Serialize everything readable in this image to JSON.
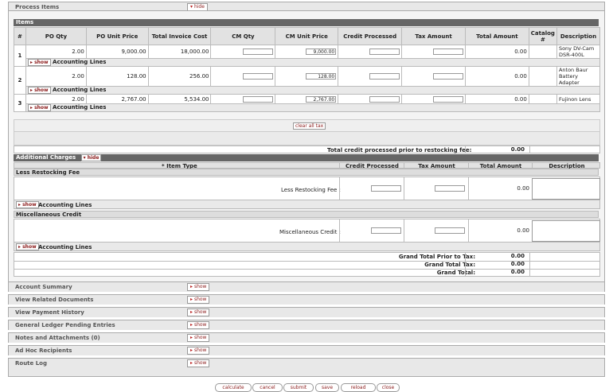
{
  "process_items": {
    "title": "Process Items",
    "hide_label": "hide"
  },
  "items": {
    "header": "Items",
    "columns": [
      "#",
      "PO Qty",
      "PO Unit Price",
      "Total Invoice Cost",
      "CM Qty",
      "CM Unit Price",
      "Credit Processed",
      "Tax Amount",
      "Total Amount",
      "Catalog #",
      "Description"
    ],
    "rows": [
      {
        "num": "1",
        "po_qty": "2.00",
        "po_unit_price": "9,000.00",
        "total_invoice_cost": "18,000.00",
        "cm_qty": "",
        "cm_unit_price": "9,000.00",
        "credit_processed": "",
        "tax_amount": "",
        "total_amount": "0.00",
        "catalog": "",
        "description": "Sony DV-Cam DSR-400L"
      },
      {
        "num": "2",
        "po_qty": "2.00",
        "po_unit_price": "128.00",
        "total_invoice_cost": "256.00",
        "cm_qty": "",
        "cm_unit_price": "128.00",
        "credit_processed": "",
        "tax_amount": "",
        "total_amount": "0.00",
        "catalog": "",
        "description": "Anton Baur Battery Adapter"
      },
      {
        "num": "3",
        "po_qty": "2.00",
        "po_unit_price": "2,767.00",
        "total_invoice_cost": "5,534.00",
        "cm_qty": "",
        "cm_unit_price": "2,767.00",
        "credit_processed": "",
        "tax_amount": "",
        "total_amount": "0.00",
        "catalog": "",
        "description": "Fujinon Lens"
      }
    ],
    "accounting_lines_label": "Accounting Lines",
    "show_label": "show",
    "clear_all_tax": "clear all tax",
    "total_credit_label": "Total credit processed prior to restocking fee:",
    "total_credit_value": "0.00"
  },
  "additional_charges": {
    "header": "Additional Charges",
    "hide_label": "hide",
    "columns": [
      "* Item Type",
      "Credit Processed",
      "Tax Amount",
      "Total Amount",
      "Description"
    ],
    "less_restocking": {
      "title": "Less Restocking Fee",
      "label": "Less Restocking Fee :",
      "total": "0.00"
    },
    "misc_credit": {
      "title": "Miscellaneous Credit",
      "label": "Miscellaneous Credit :",
      "total": "0.00"
    },
    "grand_total_prior_tax_label": "Grand Total Prior to Tax:",
    "grand_total_prior_tax": "0.00",
    "grand_total_tax_label": "Grand Total Tax:",
    "grand_total_tax": "0.00",
    "grand_total_label": "Grand Total:",
    "grand_total": "0.00"
  },
  "tabs": [
    {
      "title": "Account Summary",
      "show": "show"
    },
    {
      "title": "View Related Documents",
      "show": "show"
    },
    {
      "title": "View Payment History",
      "show": "show"
    },
    {
      "title": "General Ledger Pending Entries",
      "show": "show"
    },
    {
      "title": "Notes and Attachments (0)",
      "show": "show"
    },
    {
      "title": "Ad Hoc Recipients",
      "show": "show"
    },
    {
      "title": "Route Log",
      "show": "show"
    }
  ],
  "footer_buttons": [
    "calculate",
    "cancel",
    "submit",
    "save",
    "reload",
    "close"
  ]
}
